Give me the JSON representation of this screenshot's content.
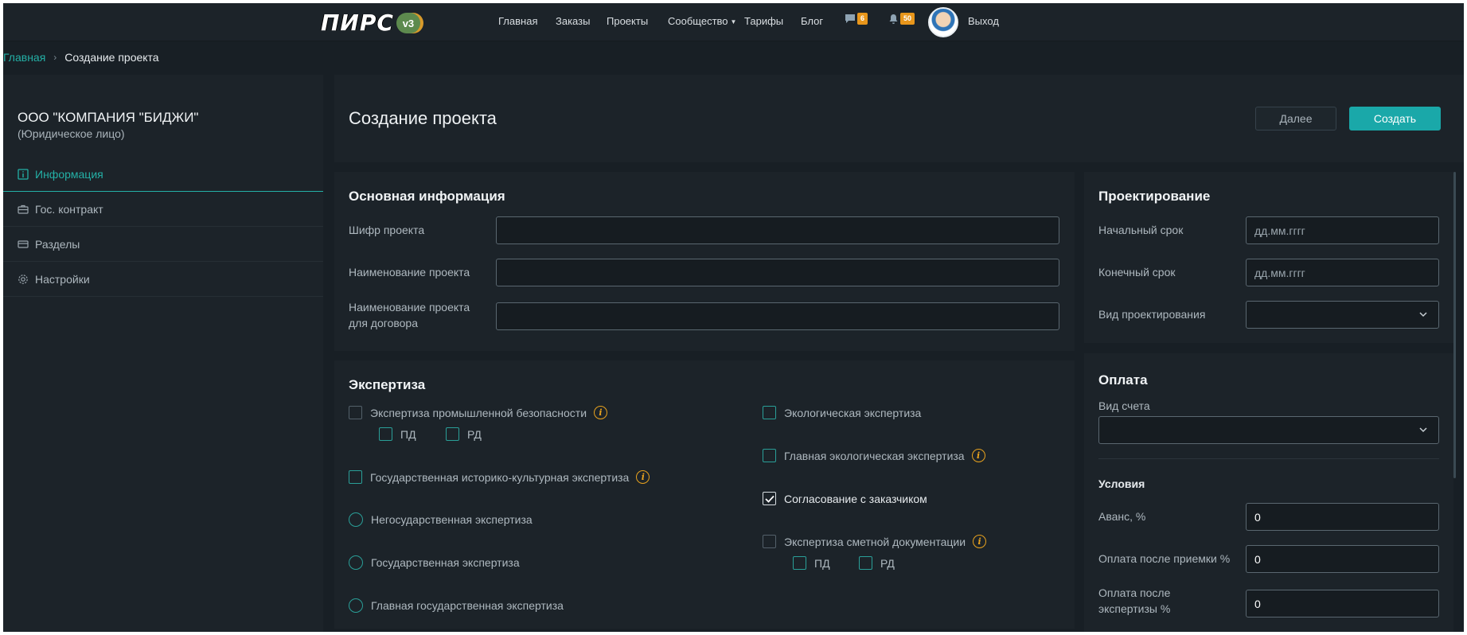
{
  "nav": {
    "logo_text": "ПИРС",
    "logo_version": "v3",
    "links": [
      "Главная",
      "Заказы",
      "Проекты",
      "Сообщество",
      "Тарифы",
      "Блог"
    ],
    "messages_count": "6",
    "notifications_count": "50",
    "logout": "Выход"
  },
  "breadcrumb": {
    "home": "Главная",
    "current": "Создание проекта"
  },
  "sidebar": {
    "org_name": "ООО \"КОМПАНИЯ \"БИДЖИ\"",
    "org_type": "(Юридическое лицо)",
    "items": [
      {
        "label": "Информация",
        "icon": "info-square-icon",
        "active": true
      },
      {
        "label": "Гос. контракт",
        "icon": "briefcase-icon",
        "active": false
      },
      {
        "label": "Разделы",
        "icon": "card-icon",
        "active": false
      },
      {
        "label": "Настройки",
        "icon": "gear-icon",
        "active": false
      }
    ]
  },
  "header": {
    "title": "Создание проекта",
    "next_label": "Далее",
    "create_label": "Создать"
  },
  "basic": {
    "title": "Основная информация",
    "cipher_label": "Шифр проекта",
    "name_label": "Наименование проекта",
    "contract_name_label_1": "Наименование проекта",
    "contract_name_label_2": "для договора",
    "cipher_value": "",
    "name_value": "",
    "contract_name_value": ""
  },
  "design": {
    "title": "Проектирование",
    "start_label": "Начальный срок",
    "end_label": "Конечный срок",
    "type_label": "Вид проектирования",
    "date_placeholder": "дд.мм.гггг",
    "type_value": ""
  },
  "expertise": {
    "title": "Экспертиза",
    "industrial": "Экспертиза промышленной безопасности",
    "pd": "ПД",
    "rd": "РД",
    "historical": "Государственная историко-культурная экспертиза",
    "nonstate": "Негосударственная экспертиза",
    "state": "Государственная экспертиза",
    "main_state": "Главная государственная экспертиза",
    "ecological": "Экологическая экспертиза",
    "main_ecological": "Главная экологическая экспертиза",
    "customer_approval": "Согласование с заказчиком",
    "estimate": "Экспертиза сметной документации",
    "customer_approval_checked": true
  },
  "payment": {
    "title": "Оплата",
    "invoice_label": "Вид счета",
    "invoice_value": "",
    "conditions_title": "Условия",
    "advance_label": "Аванс, %",
    "advance_value": "0",
    "after_acceptance_label": "Оплата после приемки %",
    "after_acceptance_value": "0",
    "after_expertise_label_1": "Оплата после",
    "after_expertise_label_2": "экспертизы %",
    "after_expertise_value": "0"
  },
  "colors": {
    "accent": "#24b0a6",
    "button": "#1aa8a9",
    "badge": "#e8961b",
    "info": "#e8a21e",
    "bg": "#181f25",
    "panel": "#1c2329"
  }
}
